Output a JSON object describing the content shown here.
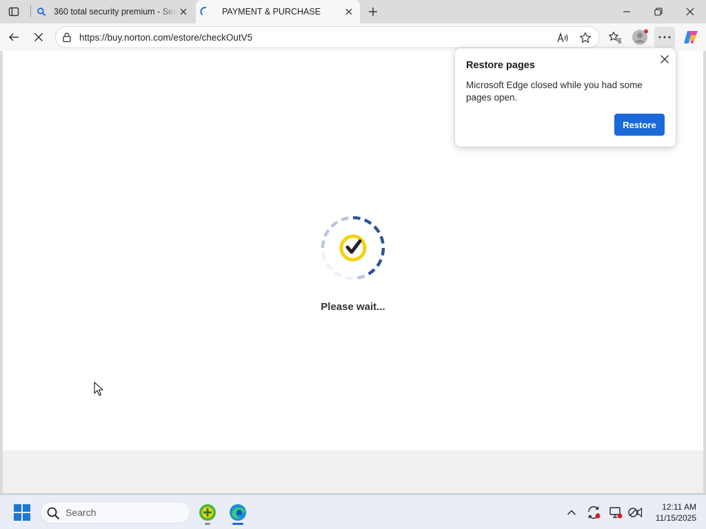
{
  "browser": {
    "tabs": [
      {
        "title": "360 total security premium - Sear",
        "favicon": "search-icon",
        "active": false
      },
      {
        "title": "PAYMENT & PURCHASE",
        "favicon": "loading-spinner-icon",
        "active": true
      }
    ],
    "address_url": "https://buy.norton.com/estore/checkOutV5",
    "accent_color": "#1a69d8"
  },
  "page": {
    "loading_text": "Please wait...",
    "spinner_colors": {
      "arc_dark": "#2f5596",
      "arc_light": "#b7c6de",
      "check_ring": "#f5d20a",
      "check_mark": "#222222"
    }
  },
  "restore_popup": {
    "title": "Restore pages",
    "message": "Microsoft Edge closed while you had some pages open.",
    "button_label": "Restore"
  },
  "taskbar": {
    "search_placeholder": "Search",
    "time": "12:11 AM",
    "date": "11/15/2025"
  }
}
